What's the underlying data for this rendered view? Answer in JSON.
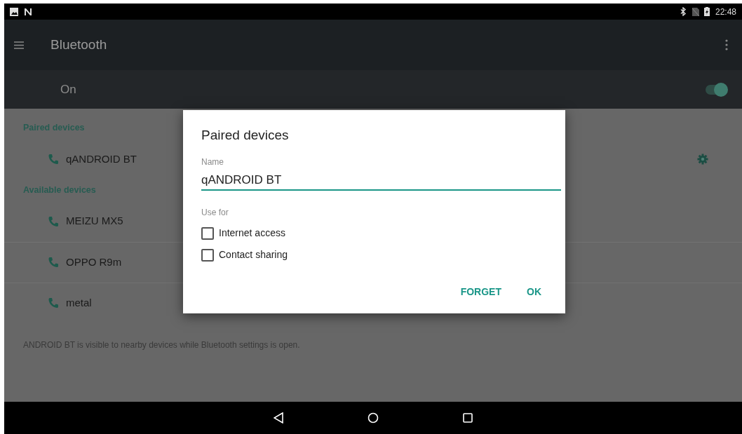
{
  "status_bar": {
    "time": "22:48"
  },
  "toolbar": {
    "title": "Bluetooth"
  },
  "master_switch": {
    "label": "On",
    "on": true
  },
  "sections": [
    {
      "heading": "Paired devices",
      "devices": [
        {
          "name": "qANDROID BT",
          "settings_button": true
        }
      ]
    },
    {
      "heading": "Available devices",
      "devices": [
        {
          "name": "MEIZU MX5",
          "settings_button": false
        },
        {
          "name": "OPPO R9m",
          "settings_button": false
        },
        {
          "name": "metal",
          "settings_button": false
        }
      ]
    }
  ],
  "footer": "ANDROID BT is visible to nearby devices while Bluetooth settings is open.",
  "dialog": {
    "title": "Paired devices",
    "name_label": "Name",
    "name_value": "qANDROID BT",
    "use_for_label": "Use for",
    "options": [
      {
        "label": "Internet access",
        "checked": false
      },
      {
        "label": "Contact sharing",
        "checked": false
      }
    ],
    "buttons": [
      "FORGET",
      "OK"
    ]
  }
}
